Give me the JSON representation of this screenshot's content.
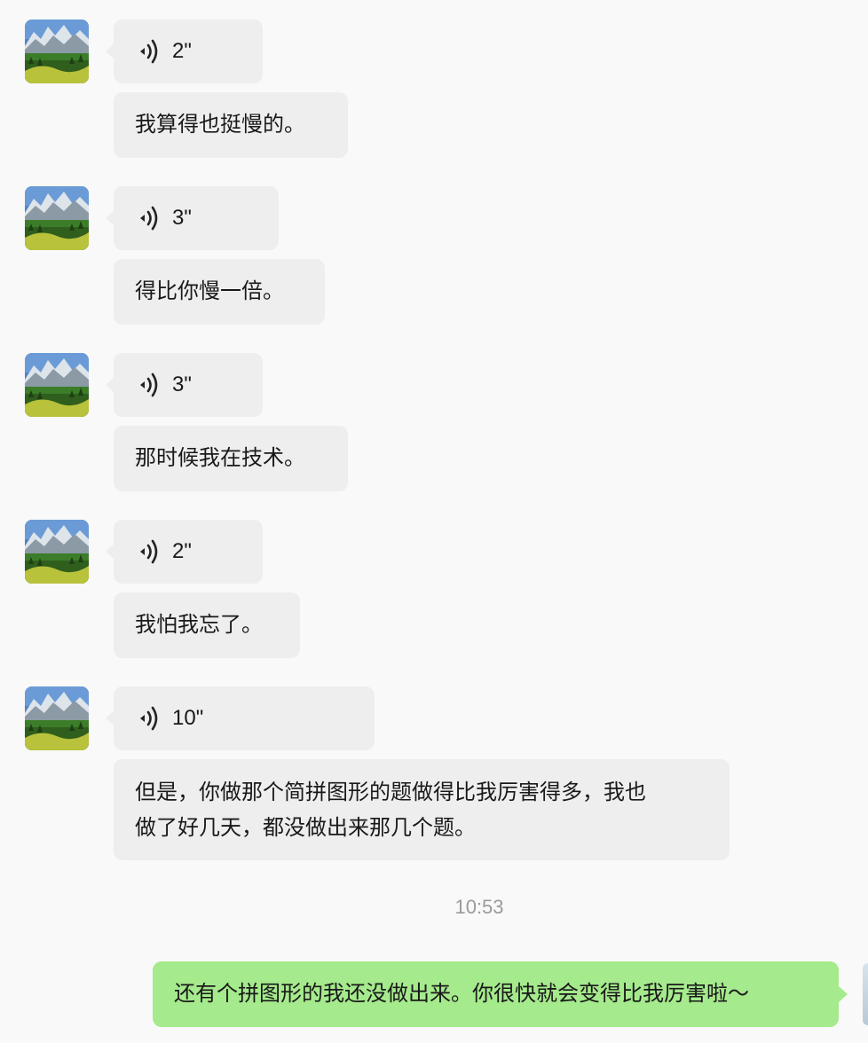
{
  "messages": [
    {
      "duration": "2\"",
      "text": "我算得也挺慢的。"
    },
    {
      "duration": "3\"",
      "text": "得比你慢一倍。"
    },
    {
      "duration": "3\"",
      "text": "那时候我在技术。"
    },
    {
      "duration": "2\"",
      "text": "我怕我忘了。"
    },
    {
      "duration": "10\"",
      "text_line1": "但是，你做那个简拼图形的题做得比我厉害得多，我也",
      "text_line2": "做了好几天，都没做出来那几个题。"
    }
  ],
  "timestamp": "10:53",
  "outgoing": {
    "text": "还有个拼图形的我还没做出来。你很快就会变得比我厉害啦～"
  },
  "colors": {
    "incoming_bubble": "#eeeeef",
    "outgoing_bubble": "#a5ea8c",
    "background": "#f9f9f9",
    "timestamp_text": "#9a9a9a"
  },
  "icons": {
    "voice": "voice-wave-icon",
    "avatar": "mountain-landscape-avatar"
  }
}
